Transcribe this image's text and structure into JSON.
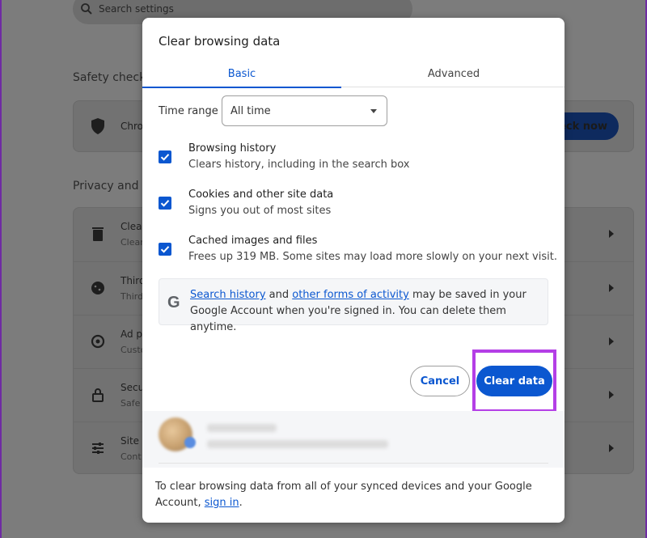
{
  "background": {
    "search_placeholder": "Search settings",
    "safety_check_title": "Safety check",
    "safety_row_text": "Chro",
    "safety_button": "eck now",
    "privacy_title": "Privacy and s",
    "privacy_rows": [
      {
        "title": "Clear",
        "sub": "Clear"
      },
      {
        "title": "Third",
        "sub": "Third"
      },
      {
        "title": "Ad p",
        "sub": "Custo"
      },
      {
        "title": "Secu",
        "sub": "Safe"
      },
      {
        "title": "Site s",
        "sub": "Cont"
      }
    ]
  },
  "dialog": {
    "title": "Clear browsing data",
    "tabs": [
      {
        "label": "Basic",
        "active": true
      },
      {
        "label": "Advanced",
        "active": false
      }
    ],
    "time_range_label": "Time range",
    "time_range_value": "All time",
    "options": [
      {
        "title": "Browsing history",
        "sub": "Clears history, including in the search box",
        "checked": true
      },
      {
        "title": "Cookies and other site data",
        "sub": "Signs you out of most sites",
        "checked": true
      },
      {
        "title": "Cached images and files",
        "sub": "Frees up 319 MB. Some sites may load more slowly on your next visit.",
        "checked": true
      }
    ],
    "info": {
      "link1": "Search history",
      "mid": " and ",
      "link2": "other forms of activity",
      "rest": " may be saved in your Google Account when you're signed in. You can delete them anytime."
    },
    "cancel_label": "Cancel",
    "clear_label": "Clear data",
    "footer_text": "To clear browsing data from all of your synced devices and your Google Account, ",
    "footer_link": "sign in",
    "footer_end": "."
  },
  "colors": {
    "accent": "#0b57d0",
    "highlight": "#b43fe6",
    "frame": "#6f2ba3"
  }
}
